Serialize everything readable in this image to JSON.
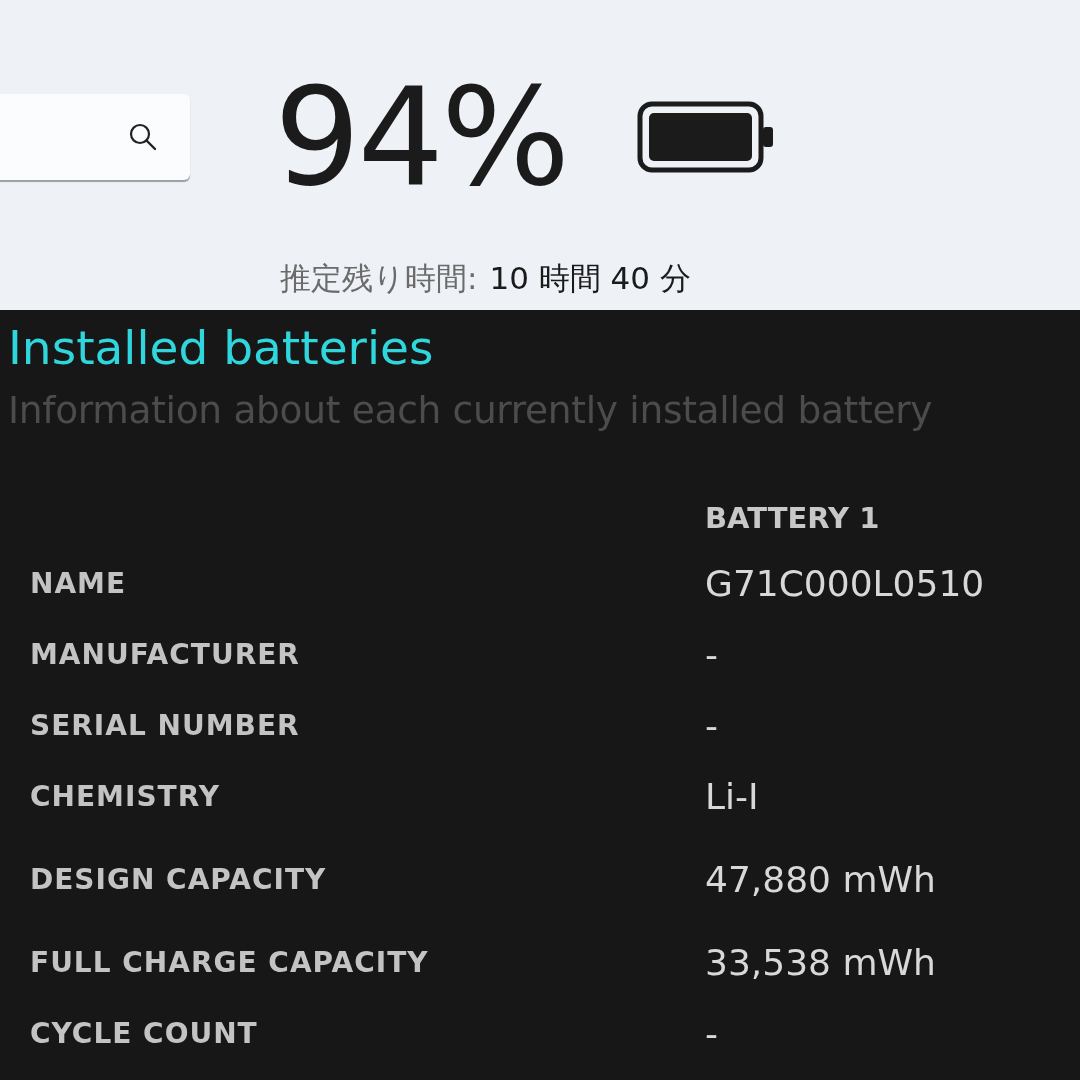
{
  "status": {
    "percent": "94%",
    "estimate_label": "推定残り時間:",
    "estimate_value": "10 時間 40 分"
  },
  "report": {
    "title": "Installed batteries",
    "subtitle": "Information about each currently installed battery",
    "columns": [
      "BATTERY 1"
    ],
    "rows": [
      {
        "label": "NAME",
        "value": "G71C000L0510"
      },
      {
        "label": "MANUFACTURER",
        "value": "-"
      },
      {
        "label": "SERIAL NUMBER",
        "value": "-"
      },
      {
        "label": "CHEMISTRY",
        "value": "Li-I"
      },
      {
        "label": "DESIGN CAPACITY",
        "value": "47,880 mWh"
      },
      {
        "label": "FULL CHARGE CAPACITY",
        "value": "33,538 mWh"
      },
      {
        "label": "CYCLE COUNT",
        "value": "-"
      }
    ]
  }
}
